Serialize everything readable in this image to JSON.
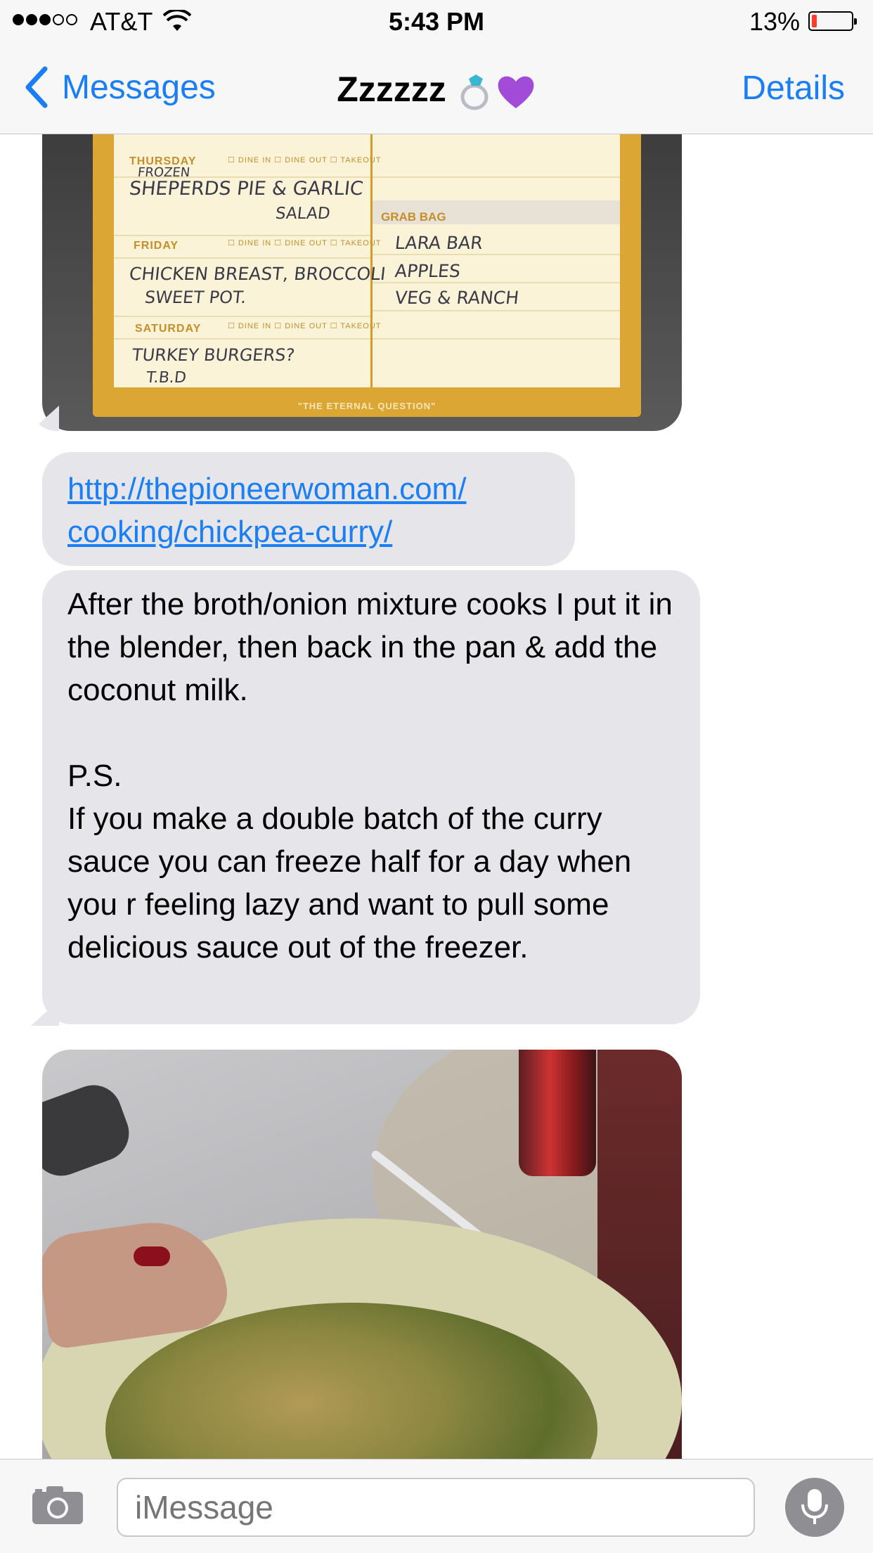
{
  "status_bar": {
    "signal_filled": 3,
    "signal_total": 5,
    "carrier": "AT&T",
    "time": "5:43 PM",
    "battery_percent": "13%",
    "battery_level": 0.13
  },
  "nav": {
    "back_label": "Messages",
    "conversation_name": "Zzzzzz",
    "details_label": "Details"
  },
  "messages": {
    "photo1_card": {
      "thursday_label": "THURSDAY",
      "thursday_text_1": "FROZEN",
      "thursday_text_2": "SHEPERDS PIE & GARLIC",
      "thursday_text_3": "SALAD",
      "friday_label": "FRIDAY",
      "friday_text_1": "CHICKEN BREAST, BROCCOLI",
      "friday_text_2": "SWEET POT.",
      "saturday_label": "SATURDAY",
      "saturday_text_1": "TURKEY BURGERS?",
      "saturday_text_2": "T.B.D",
      "grab_bag_label": "GRAB BAG",
      "grab_bag_1": "LARA BAR",
      "grab_bag_2": "APPLES",
      "grab_bag_3": "VEG & RANCH",
      "options": "☐ DINE IN  ☐ DINE OUT  ☐ TAKEOUT",
      "footer": "\"THE ETERNAL QUESTION\""
    },
    "link_line_1": "http://thepioneerwoman.com/",
    "link_line_2": "cooking/chickpea-curry/",
    "text_message": "After the broth/onion mixture cooks I put it in the blender, then back in the pan & add the coconut milk.\n\nP.S.\nIf you make a double batch of the curry sauce you can freeze half for a day when you r feeling lazy and want to pull some delicious sauce out of the freezer."
  },
  "input_bar": {
    "placeholder": "iMessage"
  },
  "colors": {
    "accent": "#1a7ff5",
    "bubble_gray": "#e5e5ea",
    "battery_low": "#ff3b30",
    "heart_purple": "#a24bd8"
  },
  "icons": {
    "back": "chevron-left-icon",
    "wifi": "wifi-icon",
    "ring": "ring-emoji-icon",
    "heart": "purple-heart-emoji-icon",
    "camera": "camera-icon",
    "mic": "microphone-icon"
  }
}
